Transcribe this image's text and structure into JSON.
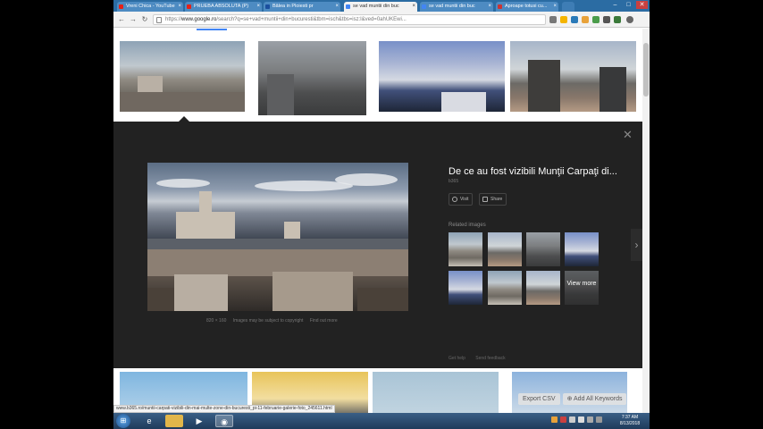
{
  "browser": {
    "tabs": [
      {
        "label": "Vreni Chica - YouTube",
        "favicon_color": "#e62117"
      },
      {
        "label": "PRUEBA ABSOLUTA (P)",
        "favicon_color": "#e62117"
      },
      {
        "label": "Bâlea in Ploiesti pr",
        "favicon_color": "#1b4f9e"
      },
      {
        "label": "se vad muntii din buc",
        "favicon_color": "#4285f4",
        "active": true
      },
      {
        "label": "se vad muntii din buc",
        "favicon_color": "#4285f4"
      },
      {
        "label": "Aproape totusi cu...",
        "favicon_color": "#c33"
      }
    ],
    "url_host": "www.google.ro",
    "url_rest": "/search?q=se+vad+muntii+din+bucuresti&tbm=isch&tbs=isz:l&ved=0ahUKEwi...",
    "url_scheme": "https://",
    "window_min": "–",
    "window_max": "□",
    "window_close": "✕"
  },
  "preview": {
    "title": "De ce au fost vizibili Munţii Carpaţi di...",
    "domain": "b365",
    "visit_label": "Visit",
    "share_label": "Share",
    "related_title": "Related images",
    "view_more": "View more",
    "image_size": "820 × 160",
    "copyright_note": "Images may be subject to copyright",
    "find_out_more": "Find out more",
    "get_help": "Get help",
    "send_feedback": "Send feedback",
    "close_glyph": "✕",
    "next_glyph": "›"
  },
  "statusbar": {
    "link": "www.b365.ro/muntii-carpati-vizibili-din-mai-multe-zone-din-bucuresti_pi-11-februarie-galerie-foto_245611.html"
  },
  "keywords_bar": {
    "export_csv": "Export CSV",
    "add_all": "⊕ Add All Keywords"
  },
  "taskbar": {
    "time": "7:37 AM",
    "date": "8/13/2018"
  },
  "colors": {
    "accent": "#4285f4",
    "panel_bg": "#222222",
    "taskbar": "#1f3b5b"
  }
}
